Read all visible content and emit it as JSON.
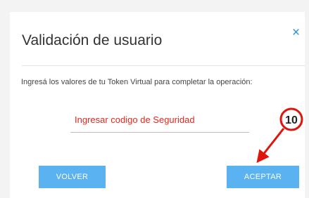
{
  "modal": {
    "title": "Validación de usuario",
    "close_symbol": "×",
    "instructions": "Ingresá los valores de tu Token Virtual para completar la operación:",
    "code_field": {
      "placeholder": "Ingresar codigo de Seguridad",
      "value": ""
    },
    "buttons": {
      "back_label": "VOLVER",
      "accept_label": "ACEPTAR"
    }
  },
  "annotation": {
    "step_number": "10"
  },
  "colors": {
    "accent_blue": "#2c8fd8",
    "button_blue": "#5bb2f0",
    "placeholder_red": "#e3271e",
    "annotation_red": "#e0140c"
  }
}
